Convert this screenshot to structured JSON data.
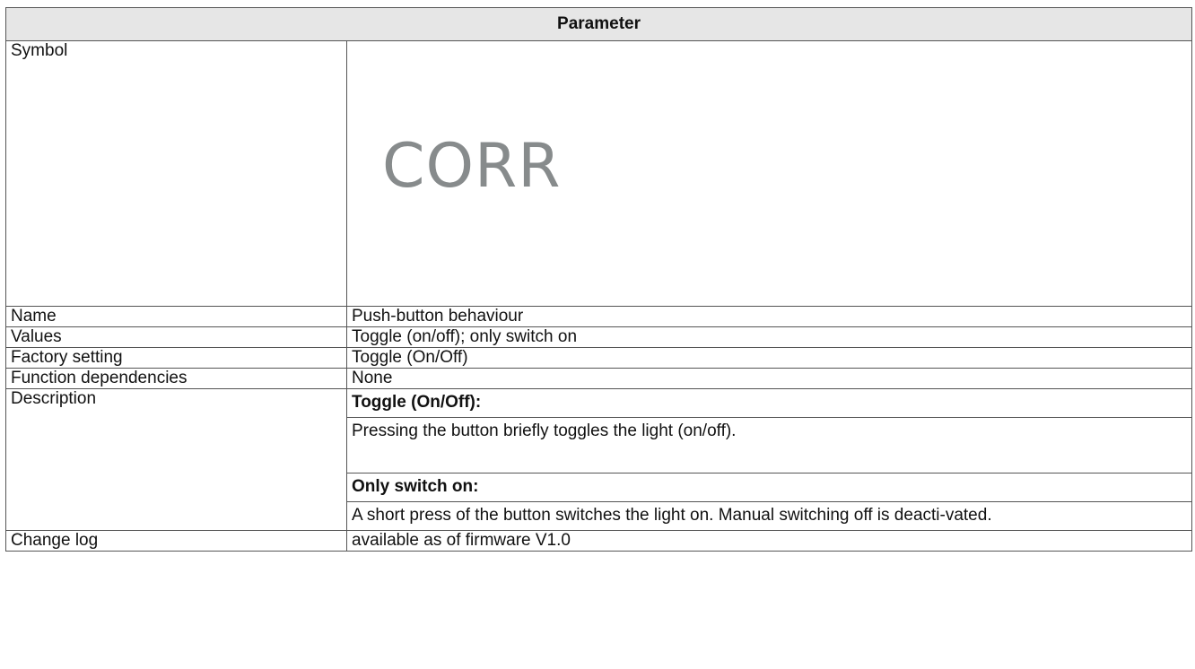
{
  "table": {
    "header": "Parameter",
    "symbol_label": "Symbol",
    "symbol_value": "CORR",
    "name_label": "Name",
    "name_value": "Push-button behaviour",
    "values_label": "Values",
    "values_value": "Toggle (on/off); only switch on",
    "factory_label": "Factory setting",
    "factory_value": "Toggle (On/Off)",
    "dependencies_label": "Function dependencies",
    "dependencies_value": "None",
    "description_label": "Description",
    "description": {
      "heading1": "Toggle (On/Off):",
      "text1": "Pressing the button briefly toggles the light (on/off).",
      "heading2": "Only switch on:",
      "text2": "A short press of the button switches the light on. Manual switching off is deacti-vated."
    },
    "changelog_label": "Change log",
    "changelog_value": "available as of firmware V1.0"
  }
}
